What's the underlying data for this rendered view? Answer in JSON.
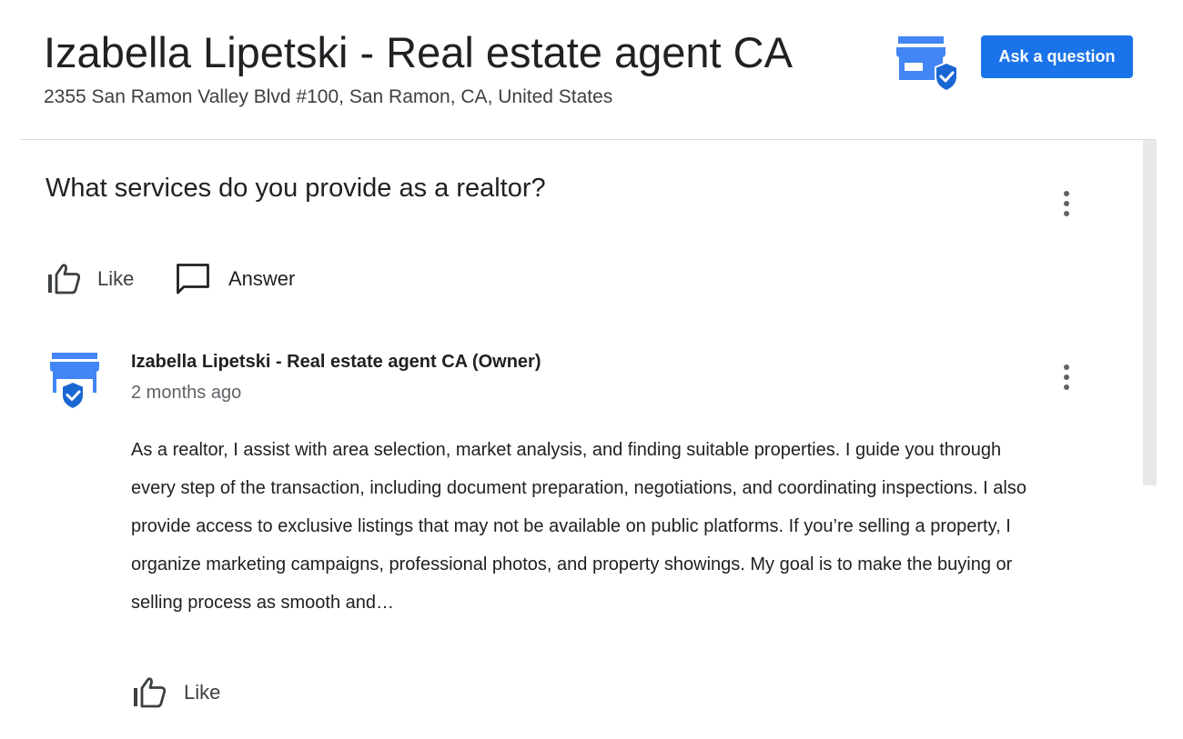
{
  "header": {
    "title": "Izabella Lipetski - Real estate agent CA",
    "address": "2355 San Ramon Valley Blvd #100, San Ramon, CA, United States",
    "business_icon": "verified-storefront-icon",
    "ask_button_label": "Ask a question"
  },
  "question": {
    "text": "What services do you provide as a realtor?",
    "menu_icon": "more-vert-icon",
    "like_icon": "thumb-up-outline-icon",
    "like_label": "Like",
    "answer_icon": "chat-bubble-outline-icon",
    "answer_label": "Answer"
  },
  "answer": {
    "avatar_icon": "verified-storefront-icon",
    "author": "Izabella Lipetski - Real estate agent CA (Owner)",
    "time": "2 months ago",
    "menu_icon": "more-vert-icon",
    "text": "As a realtor, I assist with area selection, market analysis, and finding suitable properties. I guide you through every step of the transaction, including document preparation, negotiations, and coordinating inspections. I also provide access to exclusive listings that may not be available on public platforms. If you’re selling a property, I organize marketing campaigns, professional photos, and property showings. My goal is to make the buying or selling process as smooth and…",
    "like_icon": "thumb-up-outline-icon",
    "like_label": "Like"
  },
  "colors": {
    "accent": "#1a73e8",
    "icon_blue": "#4285f4",
    "shield_blue": "#1967d2",
    "text_primary": "#202124",
    "text_secondary": "#5f6368",
    "divider": "#dadce0"
  }
}
